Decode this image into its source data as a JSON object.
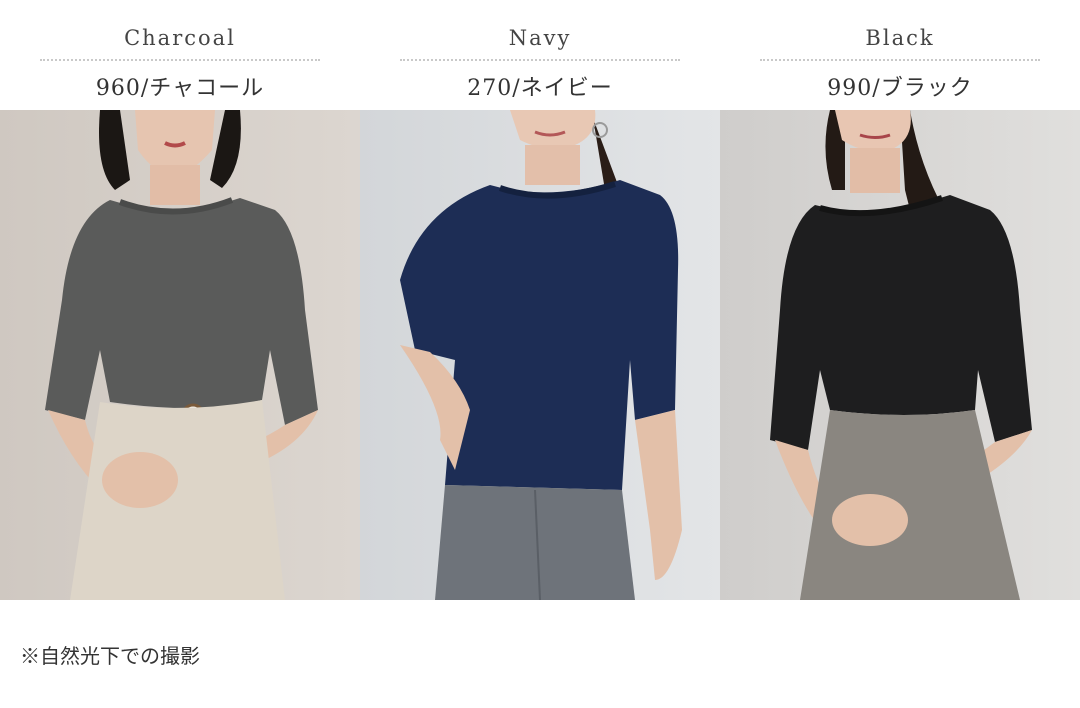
{
  "variants": [
    {
      "name_en": "Charcoal",
      "code_label": "960/チャコール",
      "shirt_color": "#5a5b5a",
      "bottom_color": "#ddd5c8",
      "bg_color": "#d6d0ca"
    },
    {
      "name_en": "Navy",
      "code_label": "270/ネイビー",
      "shirt_color": "#1d2d55",
      "bottom_color": "#6e737a",
      "bg_color": "#dcdee0"
    },
    {
      "name_en": "Black",
      "code_label": "990/ブラック",
      "shirt_color": "#1e1e1f",
      "bottom_color": "#8a8680",
      "bg_color": "#d8d7d5"
    }
  ],
  "footnote": "※自然光下での撮影"
}
